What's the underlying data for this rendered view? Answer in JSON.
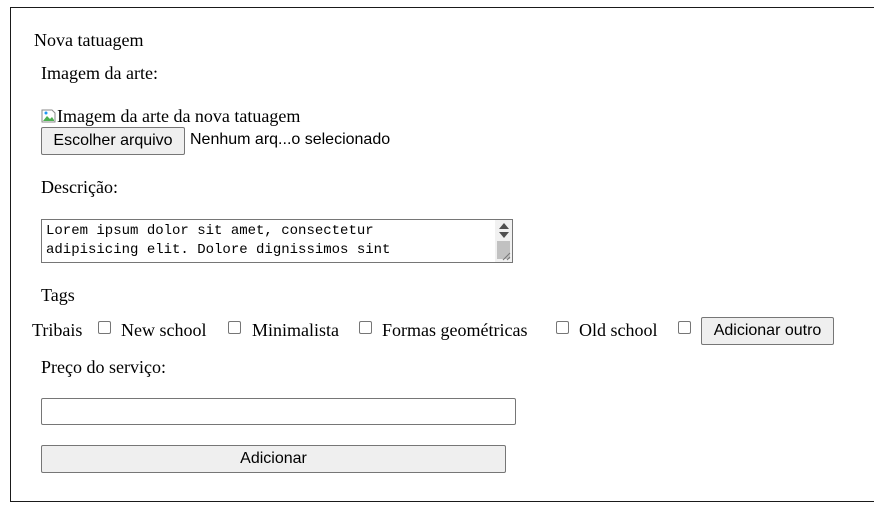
{
  "form": {
    "title": "Nova tatuagem",
    "image_label": "Imagem da arte:",
    "image_alt": "Imagem da arte da nova tatuagem",
    "file_button": "Escolher arquivo",
    "file_status": "Nenhum arq...o selecionado",
    "description_label": "Descrição:",
    "description_value": "Lorem ipsum dolor sit amet, consectetur\nadipisicing elit. Dolore dignissimos sint",
    "tags_label": "Tags",
    "tags": [
      {
        "label": "Tribais",
        "checked": false
      },
      {
        "label": "New school",
        "checked": false
      },
      {
        "label": "Minimalista",
        "checked": false
      },
      {
        "label": "Formas geométricas",
        "checked": false
      },
      {
        "label": "Old school",
        "checked": false
      }
    ],
    "add_other_button": "Adicionar outro",
    "price_label": "Preço do serviço:",
    "price_value": "",
    "submit_button": "Adicionar"
  },
  "icons": {
    "broken_image": "broken-image-icon",
    "scroll_up": "chevron-up-icon",
    "scroll_down": "chevron-down-icon",
    "resize": "resize-grip-icon"
  },
  "colors": {
    "border": "#767676",
    "button_bg": "#efefef",
    "frame": "#1a1a1a"
  }
}
